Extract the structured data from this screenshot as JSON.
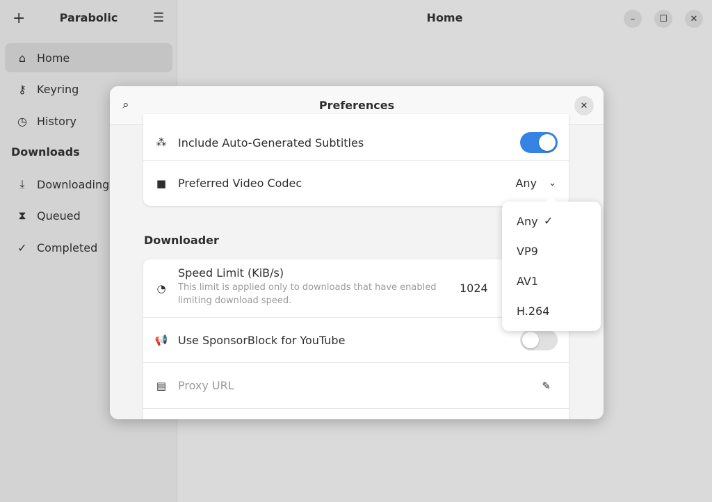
{
  "app": {
    "title": "Parabolic",
    "header_title": "Home"
  },
  "sidebar": {
    "items": [
      {
        "label": "Home",
        "icon": "home-icon"
      },
      {
        "label": "Keyring",
        "icon": "key-icon"
      },
      {
        "label": "History",
        "icon": "history-icon"
      }
    ],
    "section": "Downloads",
    "downloads": [
      {
        "label": "Downloading",
        "icon": "download-icon"
      },
      {
        "label": "Queued",
        "icon": "hourglass-icon"
      },
      {
        "label": "Completed",
        "icon": "check-circle-icon"
      }
    ]
  },
  "dialog": {
    "title": "Preferences",
    "rows1": [
      {
        "label": "Include Auto-Generated Subtitles",
        "toggle": true
      },
      {
        "label": "Preferred Video Codec",
        "value": "Any"
      }
    ],
    "downloader_heading": "Downloader",
    "speed": {
      "label": "Speed Limit (KiB/s)",
      "subtitle": "This limit is applied only to downloads that have enabled limiting download speed.",
      "value": "1024"
    },
    "sponsorblock": {
      "label": "Use SponsorBlock for YouTube",
      "toggle": false
    },
    "proxy": {
      "placeholder": "Proxy URL"
    }
  },
  "codec_menu": {
    "options": [
      "Any",
      "VP9",
      "AV1",
      "H.264"
    ],
    "selected": "Any"
  },
  "colors": {
    "accent": "#3584e4"
  }
}
